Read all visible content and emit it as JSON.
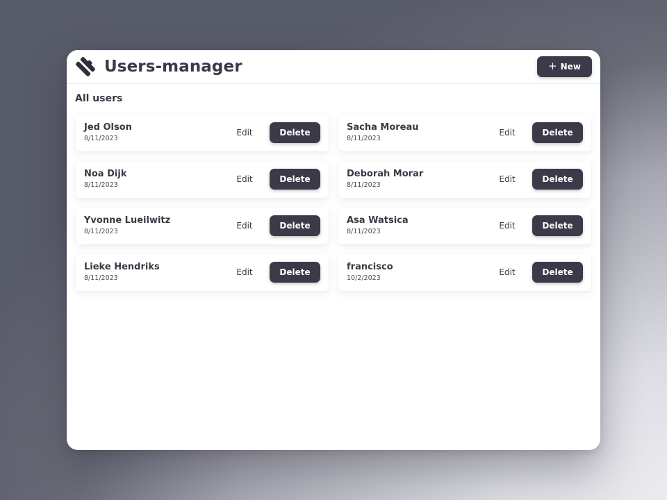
{
  "app": {
    "title": "Users-manager",
    "logo_icon": "logo-diamond-icon"
  },
  "header": {
    "new_button_label": "New",
    "new_button_icon": "plus-icon"
  },
  "section": {
    "title": "All users"
  },
  "actions": {
    "edit_label": "Edit",
    "delete_label": "Delete"
  },
  "users": [
    {
      "name": "Jed Olson",
      "date": "8/11/2023"
    },
    {
      "name": "Sacha Moreau",
      "date": "8/11/2023"
    },
    {
      "name": "Noa Dijk",
      "date": "8/11/2023"
    },
    {
      "name": "Deborah Morar",
      "date": "8/11/2023"
    },
    {
      "name": "Yvonne Lueilwitz",
      "date": "8/11/2023"
    },
    {
      "name": "Asa Watsica",
      "date": "8/11/2023"
    },
    {
      "name": "Lieke Hendriks",
      "date": "8/11/2023"
    },
    {
      "name": "francisco",
      "date": "10/2/2023"
    }
  ],
  "colors": {
    "primary_button": "#3b3a49",
    "text": "#3a3945",
    "surface": "#ffffff"
  }
}
